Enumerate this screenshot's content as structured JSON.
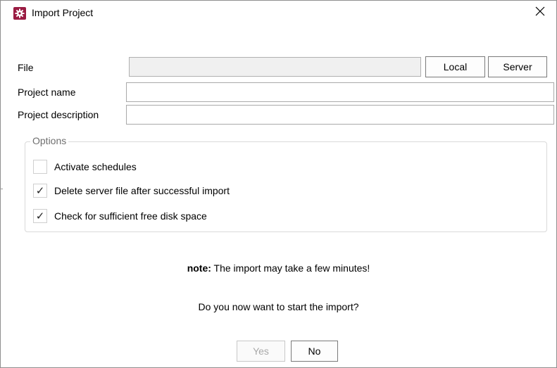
{
  "window": {
    "title": "Import Project",
    "icon": "gear-icon",
    "accent_color": "#9a1b42",
    "close_glyph": "✕"
  },
  "form": {
    "file_label": "File",
    "file_value": "",
    "local_button": "Local",
    "server_button": "Server",
    "project_name_label": "Project name",
    "project_name_value": "",
    "project_description_label": "Project description",
    "project_description_value": ""
  },
  "options": {
    "legend": "Options",
    "items": [
      {
        "label": "Activate schedules",
        "checked": false,
        "mark": ""
      },
      {
        "label": "Delete server file after successful import",
        "checked": true,
        "mark": "✓"
      },
      {
        "label": "Check for sufficient free disk space",
        "checked": true,
        "mark": "✓"
      }
    ]
  },
  "messages": {
    "note_prefix": "note:",
    "note_text": " The import may take a few minutes!",
    "question": "Do you now want to start the import?"
  },
  "buttons": {
    "yes": "Yes",
    "yes_enabled": false,
    "no": "No"
  }
}
